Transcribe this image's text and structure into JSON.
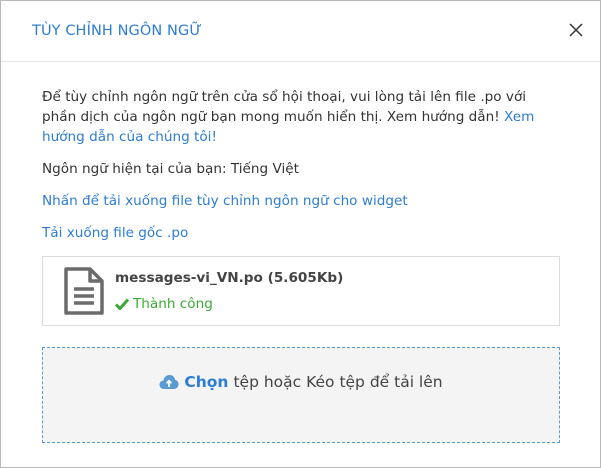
{
  "dialog": {
    "title": "TÙY CHỈNH NGÔN NGỮ",
    "close_icon": "close-icon"
  },
  "body": {
    "intro_text": "Để tùy chỉnh ngôn ngữ trên cửa sổ hội thoại, vui lòng tải lên file .po với phần dịch của ngôn ngữ bạn mong muốn hiển thị. Xem hướng dẫn! ",
    "intro_link": "Xem hướng dẫn của chúng tôi!",
    "current_language": "Ngôn ngữ hiện tại của bạn: Tiếng Việt",
    "download_custom_link": "Nhấn để tải xuống file tùy chỉnh ngôn ngữ cho widget",
    "download_original_link": "Tải xuống file gốc .po"
  },
  "file": {
    "icon": "document-icon",
    "name": "messages-vi_VN.po (5.605Kb)",
    "status": "Thành công",
    "status_icon": "check-icon",
    "status_color": "#3aaa35"
  },
  "dropzone": {
    "icon": "cloud-upload-icon",
    "choose_label": "Chọn",
    "rest_label": "tệp hoặc Kéo tệp để tải lên"
  },
  "colors": {
    "accent": "#2d7dd2",
    "dropzone_border": "#5b9bd5"
  }
}
